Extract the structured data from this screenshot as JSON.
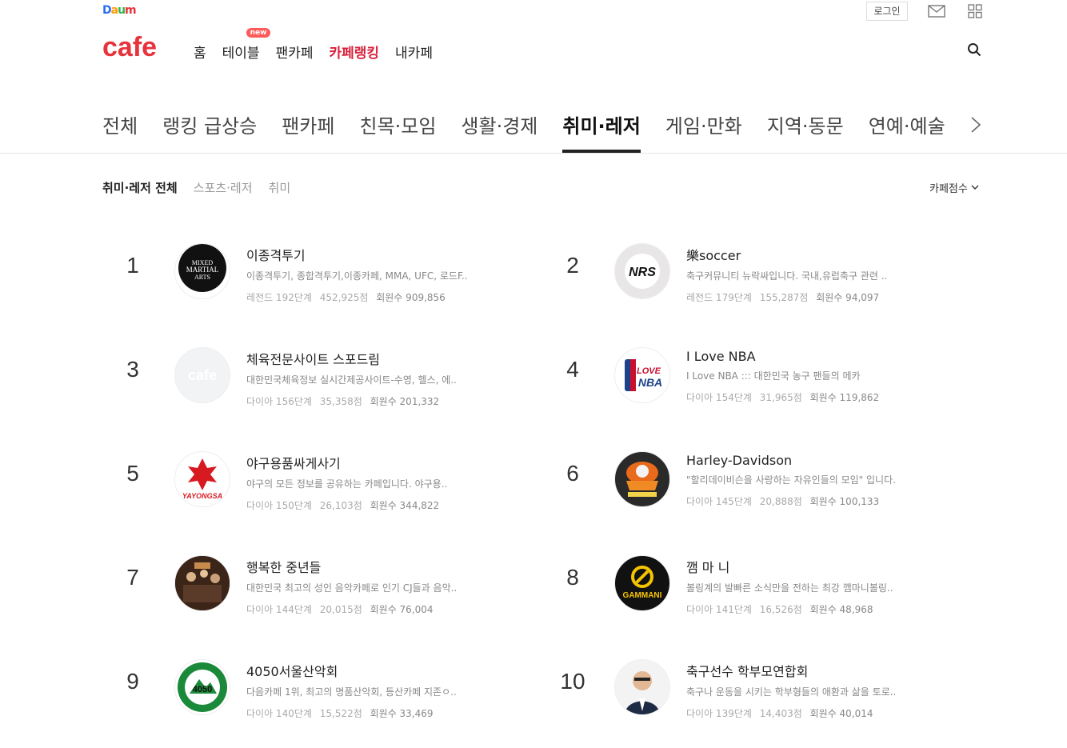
{
  "header": {
    "daum_logo": "Daum",
    "cafe_logo": "cafe",
    "login_label": "로그인",
    "nav": [
      {
        "label": "홈"
      },
      {
        "label": "테이블",
        "badge": "new"
      },
      {
        "label": "팬카페"
      },
      {
        "label": "카페랭킹",
        "active": true
      },
      {
        "label": "내카페"
      }
    ]
  },
  "tabs": [
    "전체",
    "랭킹 급상승",
    "팬카페",
    "친목·모임",
    "생활·경제",
    "취미·레저",
    "게임·만화",
    "지역·동문",
    "연예·예술"
  ],
  "active_tab": "취미·레저",
  "subnav": [
    "취미·레저 전체",
    "스포츠·레저",
    "취미"
  ],
  "sort_label": "카페점수",
  "rankings": [
    {
      "rank": "1",
      "name": "이종격투기",
      "desc": "이종격투기, 종합격투기,이종카페, MMA, UFC, 로드F..",
      "level": "레전드 192단계",
      "score": "452,925점",
      "members": "회원수 909,856",
      "thumb": "mma-logo"
    },
    {
      "rank": "2",
      "name": "樂soccer",
      "desc": "축구커뮤니티 뉴락싸입니다. 국내,유럽축구 관련 ..",
      "level": "레전드 179단계",
      "score": "155,287점",
      "members": "회원수 94,097",
      "thumb": "nrs-logo"
    },
    {
      "rank": "3",
      "name": "체육전문사이트 스포드림",
      "desc": "대한민국체육정보 실시간제공사이트-수영, 헬스, 에..",
      "level": "다이아 156단계",
      "score": "35,358점",
      "members": "회원수 201,332",
      "thumb": "cafe-default"
    },
    {
      "rank": "4",
      "name": "I Love NBA",
      "desc": "I Love NBA ::: 대한민국 농구 팬들의 메카",
      "level": "다이아 154단계",
      "score": "31,965점",
      "members": "회원수 119,862",
      "thumb": "nba-logo"
    },
    {
      "rank": "5",
      "name": "야구용품싸게사기",
      "desc": "야구의 모든 정보를 공유하는 카페입니다. 야구용..",
      "level": "다이아 150단계",
      "score": "26,103점",
      "members": "회원수 344,822",
      "thumb": "yayongsa-logo"
    },
    {
      "rank": "6",
      "name": "Harley-Davidson",
      "desc": "\"할리데이비슨을 사랑하는 자유인들의 모임\" 입니다.",
      "level": "다이아 145단계",
      "score": "20,888점",
      "members": "회원수 100,133",
      "thumb": "eagle-logo"
    },
    {
      "rank": "7",
      "name": "행복한 중년들",
      "desc": "대한민국 최고의 성인 음악카페로 인기 CJ들과 음악..",
      "level": "다이아 144단계",
      "score": "20,015점",
      "members": "회원수 76,004",
      "thumb": "photo"
    },
    {
      "rank": "8",
      "name": "깸 마 니",
      "desc": "볼링계의 발빠른 소식만을 전하는 최강 깸마니볼링..",
      "level": "다이아 141단계",
      "score": "16,526점",
      "members": "회원수 48,968",
      "thumb": "gammani-logo"
    },
    {
      "rank": "9",
      "name": "4050서울산악회",
      "desc": "다음카페 1위, 최고의 명품산악회, 등산카페 지존ㅇ..",
      "level": "다이아 140단계",
      "score": "15,522점",
      "members": "회원수 33,469",
      "thumb": "seoul-mountain-logo"
    },
    {
      "rank": "10",
      "name": "축구선수 학부모연합회",
      "desc": "축구나 운동을 시키는 학부형들의 애환과 삶을 토로..",
      "level": "다이아 139단계",
      "score": "14,403점",
      "members": "회원수 40,014",
      "thumb": "portrait"
    }
  ]
}
